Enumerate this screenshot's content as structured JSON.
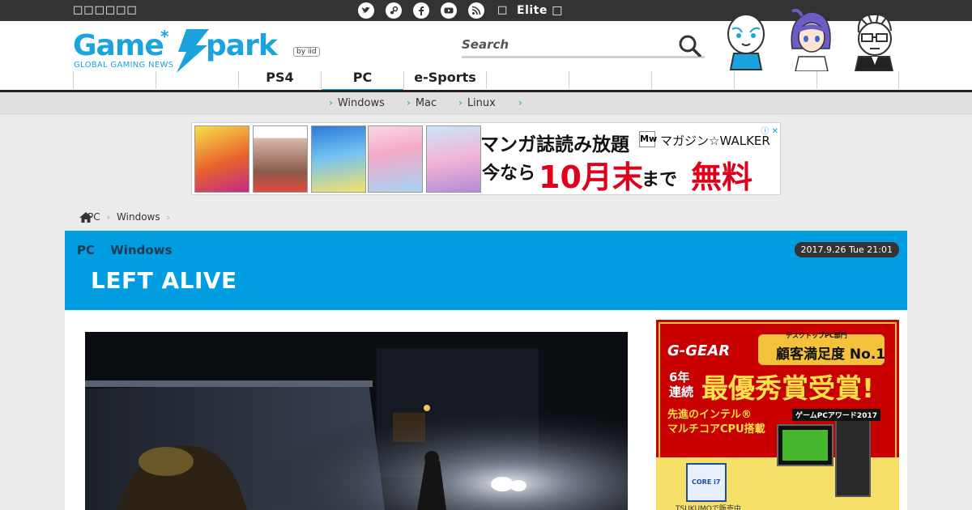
{
  "topbar": {
    "left_text": "□□□□□□",
    "login_glyph": "□",
    "elite_text": "Elite □",
    "social_icons": [
      "twitter-icon",
      "steam-icon",
      "facebook-icon",
      "youtube-icon",
      "rss-icon"
    ]
  },
  "header": {
    "logo_text": "Game*Spark",
    "logo_sub": "GLOBAL GAMING NEWS",
    "logo_byline": "by iid",
    "search_placeholder": "Search"
  },
  "nav": {
    "items": [
      "",
      "",
      "PS4",
      "PC",
      "e-Sports",
      "",
      "",
      "",
      "",
      ""
    ],
    "selected_index": 3
  },
  "subnav": {
    "items": [
      "Windows",
      "Mac",
      "Linux",
      ""
    ]
  },
  "ad_banner": {
    "headline": "マンガ誌読み放題",
    "brand": "マガジン☆WALKER",
    "line2_prefix": "今なら",
    "line2_big": "10月末",
    "line2_suffix": "まで",
    "free": "無料"
  },
  "breadcrumb": {
    "items": [
      "PC",
      "Windows"
    ]
  },
  "article": {
    "categories": [
      "PC",
      "Windows"
    ],
    "date": "2017.9.26 Tue 21:01",
    "title": "LEFT ALIVE"
  },
  "side_ad": {
    "brand": "G-GEAR",
    "badge1": "デスクトップPC部門",
    "badge2": "顧客満足度 No.1",
    "years": "6年連続",
    "award": "最優秀賞受賞!",
    "line1": "先進のインテル®",
    "line2": "マルチコアCPU搭載",
    "award_label": "ゲームPCアワード2017",
    "footer": "TSUKUMOで販売中",
    "cpu": "CORE i7"
  },
  "colors": {
    "brand_blue": "#1aa3dc",
    "article_bar": "#009ee0",
    "topbar": "#333333",
    "ad_red": "#e0001a"
  }
}
